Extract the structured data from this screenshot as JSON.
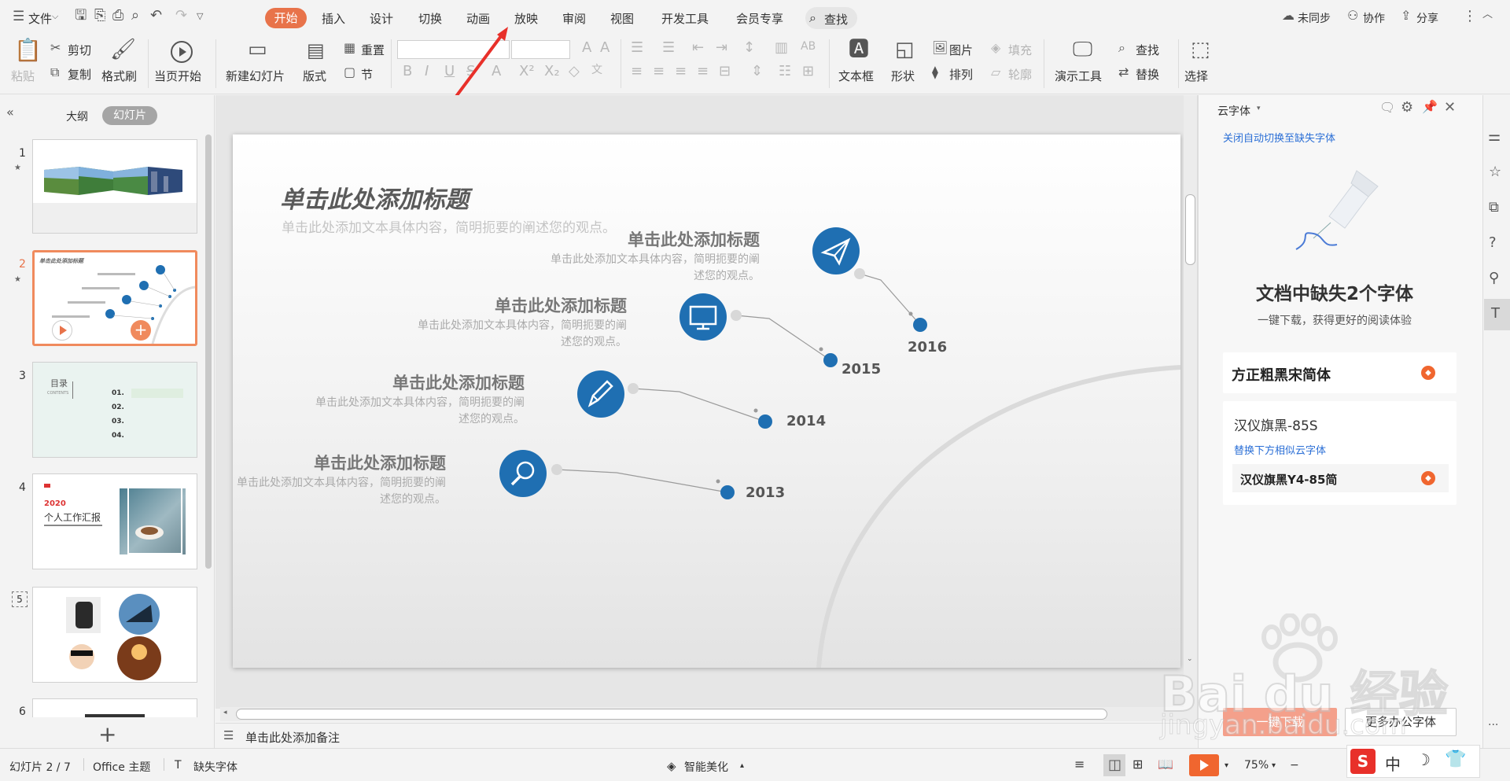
{
  "menu": {
    "file": "文件",
    "tabs": [
      "开始",
      "插入",
      "设计",
      "切换",
      "动画",
      "放映",
      "审阅",
      "视图",
      "开发工具",
      "会员专享"
    ],
    "find": "查找",
    "sync": "未同步",
    "collab": "协作",
    "share": "分享"
  },
  "ribbon": {
    "paste": "粘贴",
    "cut": "剪切",
    "copy": "复制",
    "format_painter": "格式刷",
    "play_current": "当页开始",
    "new_slide": "新建幻灯片",
    "layout": "版式",
    "reset": "重置",
    "section": "节",
    "textbox": "文本框",
    "shape": "形状",
    "picture": "图片",
    "fill": "填充",
    "arrange": "排列",
    "outline": "轮廓",
    "present_tool": "演示工具",
    "find": "查找",
    "replace": "替换",
    "select": "选择"
  },
  "left_panel": {
    "tab_outline": "大纲",
    "tab_slides": "幻灯片",
    "slide_numbers": [
      "1",
      "2",
      "3",
      "4",
      "5",
      "6"
    ],
    "slide2_title": "单击此处添加标题",
    "slide3": {
      "title": "目录",
      "sub": "CONTENTS",
      "items": [
        "01.",
        "02.",
        "03.",
        "04."
      ]
    },
    "slide4": {
      "year": "2020",
      "title": "个人工作汇报"
    }
  },
  "slide": {
    "title": "单击此处添加标题",
    "subtitle": "单击此处添加文本具体内容，简明扼要的阐述您的观点。",
    "items": [
      {
        "title": "单击此处添加标题",
        "desc1": "单击此处添加文本具体内容，简明扼要的阐",
        "desc2": "述您的观点。",
        "year": "2016",
        "icon": "paper-plane-icon"
      },
      {
        "title": "单击此处添加标题",
        "desc1": "单击此处添加文本具体内容，简明扼要的阐",
        "desc2": "述您的观点。",
        "year": "2015",
        "icon": "monitor-icon"
      },
      {
        "title": "单击此处添加标题",
        "desc1": "单击此处添加文本具体内容，简明扼要的阐",
        "desc2": "述您的观点。",
        "year": "2014",
        "icon": "pencil-icon"
      },
      {
        "title": "单击此处添加标题",
        "desc1": "单击此处添加文本具体内容，简明扼要的阐",
        "desc2": "述您的观点。",
        "year": "2013",
        "icon": "search-icon"
      }
    ]
  },
  "notes_placeholder": "单击此处添加备注",
  "right_panel": {
    "title": "云字体",
    "auto_switch": "关闭自动切换至缺失字体",
    "missing_heading": "文档中缺失2个字体",
    "missing_sub": "一键下载，获得更好的阅读体验",
    "font1": "方正粗黑宋简体",
    "font2": "汉仪旗黑-85S",
    "replace_hint": "替换下方相似云字体",
    "font2_replacement": "汉仪旗黑Y4-85简",
    "download_all": "一键下载",
    "more_fonts": "更多办公字体"
  },
  "status": {
    "slide_index": "幻灯片 2 / 7",
    "theme": "Office 主题",
    "missing_font": "缺失字体",
    "smart_beautify": "智能美化",
    "zoom": "75%"
  },
  "watermark": {
    "logo": "Bai du 经验",
    "url": "jingyan.baidu.com"
  },
  "ime": {
    "lang": "中"
  },
  "colors": {
    "accent": "#e8734a",
    "timeline_blue": "#1f6fb2",
    "link": "#2b6fd6"
  }
}
